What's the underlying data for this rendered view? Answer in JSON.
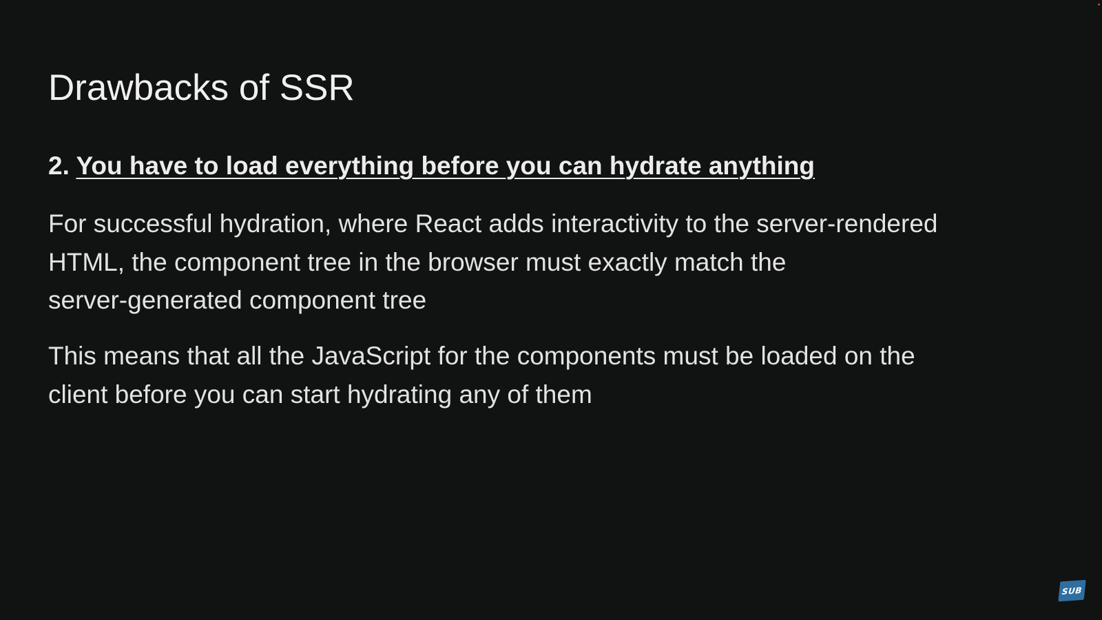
{
  "slide": {
    "title": "Drawbacks of SSR",
    "point": {
      "number": "2.",
      "heading": "You have to load everything before you can hydrate anything"
    },
    "paragraphs": [
      {
        "lines": [
          "For successful hydration, where React adds interactivity to the server-rendered",
          "HTML, the component tree in the browser must exactly match the",
          "server-generated component tree"
        ]
      },
      {
        "lines": [
          "This means that all the JavaScript for the components must be loaded on the",
          "client before you can start hydrating any of them"
        ]
      }
    ]
  },
  "badge": {
    "label": "SUB",
    "color": "#2f6ea0"
  },
  "colors": {
    "background": "#111212",
    "text": "#e3e3e3"
  }
}
